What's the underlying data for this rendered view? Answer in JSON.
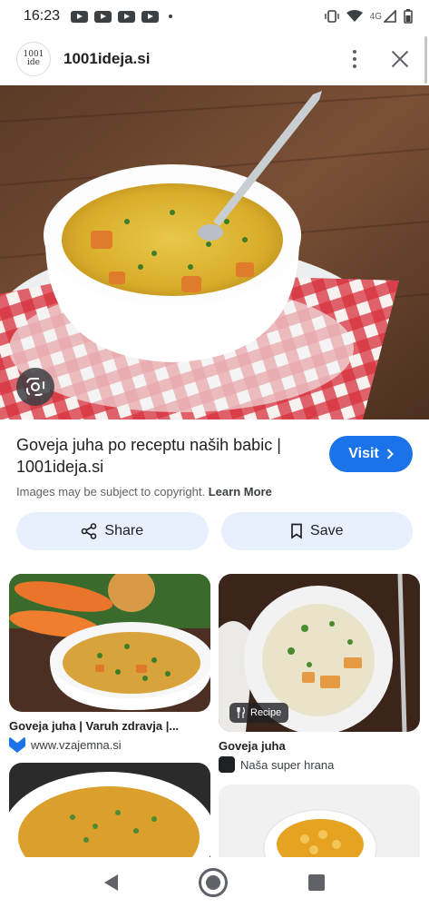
{
  "status_bar": {
    "time": "16:23",
    "network": "4G"
  },
  "header": {
    "logo_text": "1001 ide",
    "site_name": "1001ideja.si"
  },
  "result": {
    "title": "Goveja juha po receptu naših babic | 1001ideja.si",
    "visit_label": "Visit",
    "copyright_text": "Images may be subject to copyright.",
    "learn_more": "Learn More"
  },
  "actions": {
    "share_label": "Share",
    "save_label": "Save"
  },
  "related": [
    {
      "caption": "Goveja juha | Varuh zdravja |...",
      "source": "www.vzajemna.si",
      "source_color": "#1a73e8"
    },
    {
      "caption": "Goveja juha",
      "source": "Naša super hrana",
      "badge": "Recipe",
      "source_color": "#202124"
    }
  ],
  "colors": {
    "accent": "#1a73e8",
    "pill_bg": "#e8f0fe"
  }
}
